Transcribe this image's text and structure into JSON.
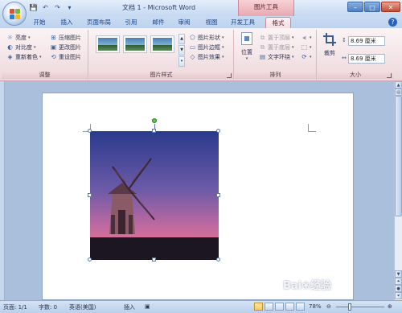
{
  "titlebar": {
    "doc_title": "文档 1 - Microsoft Word",
    "context_tab_title": "图片工具",
    "qat": [
      "save-icon",
      "undo-icon",
      "redo-icon",
      "more-icon"
    ],
    "window_controls": [
      "minimize",
      "maximize",
      "close"
    ]
  },
  "tabs": [
    {
      "label": "开始",
      "active": false
    },
    {
      "label": "插入",
      "active": false
    },
    {
      "label": "页面布局",
      "active": false
    },
    {
      "label": "引用",
      "active": false
    },
    {
      "label": "邮件",
      "active": false
    },
    {
      "label": "审阅",
      "active": false
    },
    {
      "label": "视图",
      "active": false
    },
    {
      "label": "开发工具",
      "active": false
    },
    {
      "label": "格式",
      "active": true
    }
  ],
  "ribbon": {
    "adjust": {
      "label": "调整",
      "commands": [
        "亮度",
        "对比度",
        "重新着色",
        "压缩图片",
        "更改图片",
        "重设图片"
      ]
    },
    "picture_styles": {
      "label": "图片样式",
      "commands": [
        "图片形状",
        "图片边框",
        "图片效果"
      ]
    },
    "arrange": {
      "label": "排列",
      "position": "位置",
      "commands": [
        "置于顶层",
        "置于底层",
        "文字环绕"
      ]
    },
    "size": {
      "label": "大小",
      "crop": "裁剪",
      "height": "8.69 厘米",
      "width": "8.69 厘米"
    }
  },
  "statusbar": {
    "page": "页面: 1/1",
    "words": "字数: 0",
    "language": "英语(美国)",
    "insert_mode": "插入",
    "zoom": "78%"
  },
  "colors": {
    "context_tab": "#f5dde0",
    "ribbon_blue": "#c9dbf3",
    "sky_top": "#2b3a8c",
    "sky_bottom": "#e7738f"
  },
  "watermark": "Bai❀经验"
}
